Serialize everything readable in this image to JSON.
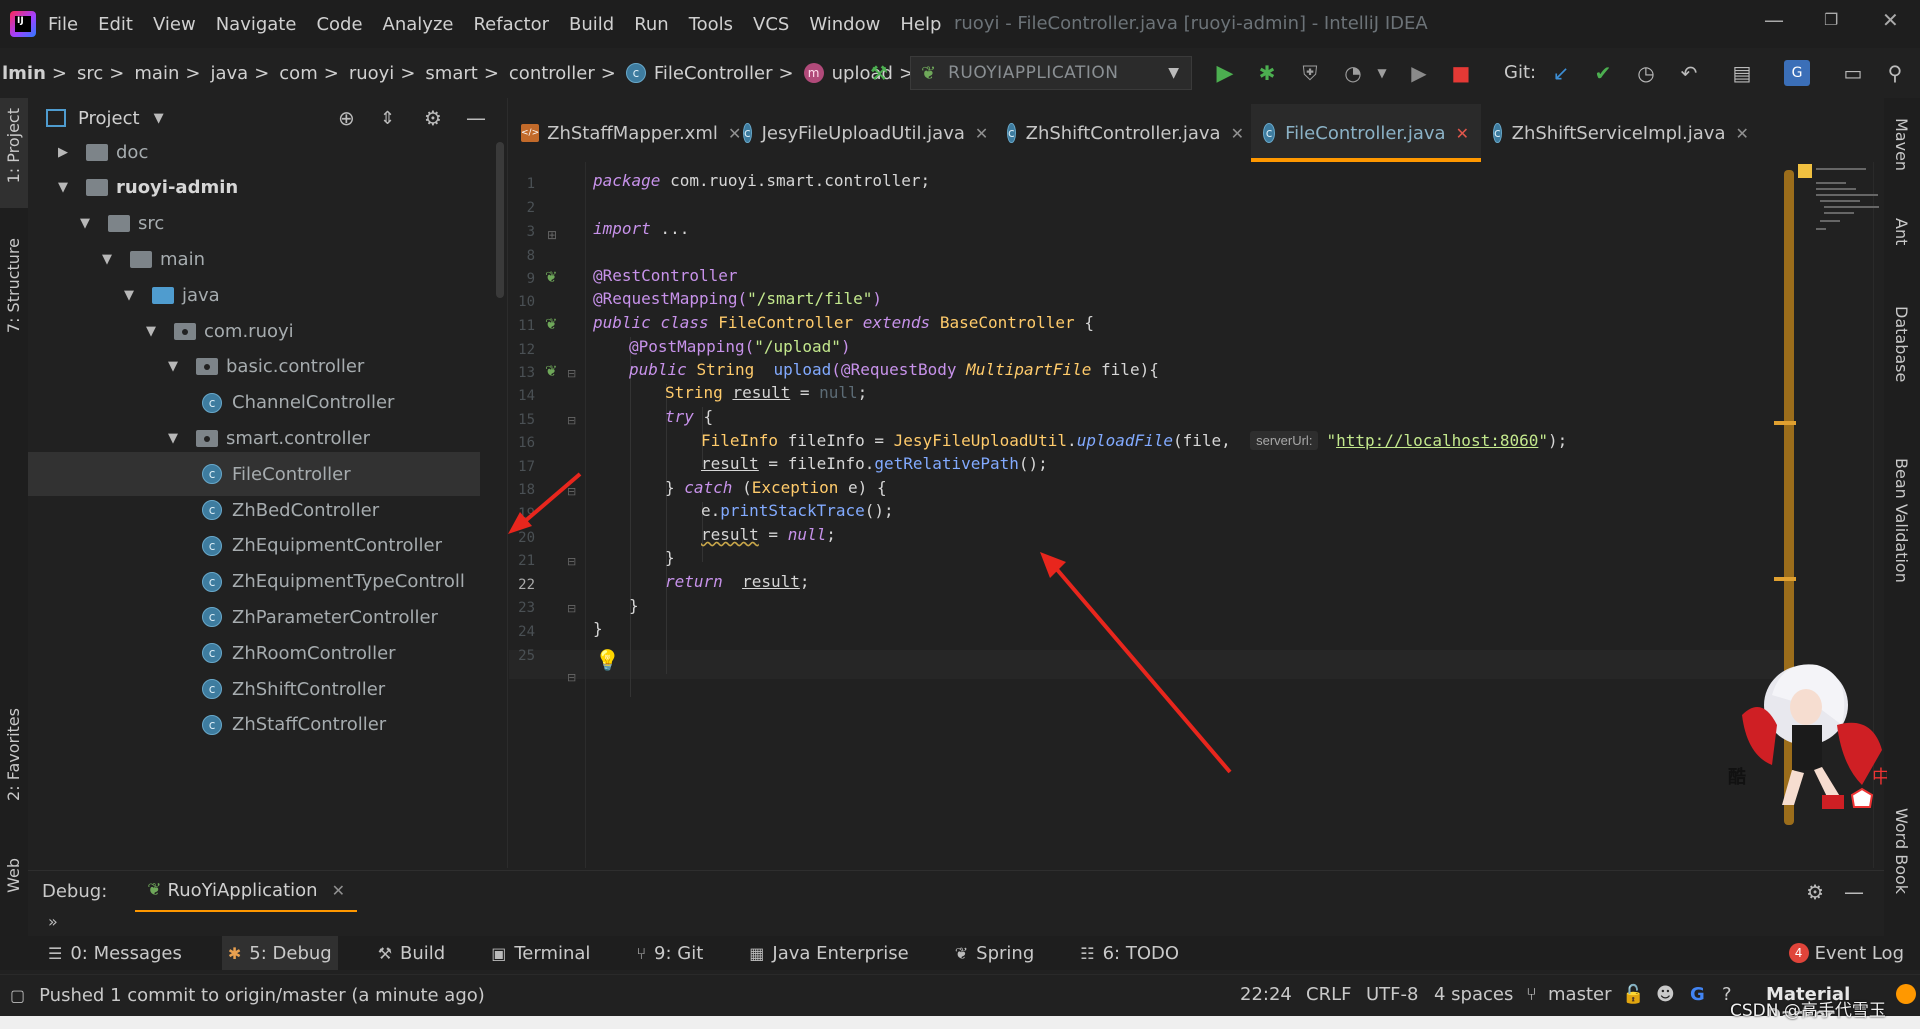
{
  "window": {
    "title": "ruoyi - FileController.java [ruoyi-admin] - IntelliJ IDEA"
  },
  "menu": [
    "File",
    "Edit",
    "View",
    "Navigate",
    "Code",
    "Analyze",
    "Refactor",
    "Build",
    "Run",
    "Tools",
    "VCS",
    "Window",
    "Help"
  ],
  "breadcrumb": [
    "lmin",
    "src",
    "main",
    "java",
    "com",
    "ruoyi",
    "smart",
    "controller",
    "FileController",
    "upload"
  ],
  "toolbar": {
    "run_config": "RUOYIAPPLICATION",
    "git_label": "Git:"
  },
  "left_strip": {
    "project": "1: Project",
    "structure": "7: Structure",
    "favorites": "2: Favorites",
    "web": "Web"
  },
  "right_strip": {
    "maven": "Maven",
    "ant": "Ant",
    "database": "Database",
    "bean_validation": "Bean Validation",
    "word_book": "Word Book"
  },
  "project_panel": {
    "title": "Project",
    "tree": [
      {
        "label": "doc",
        "arrow": "▶",
        "icon": "folder"
      },
      {
        "label": "ruoyi-admin",
        "arrow": "▼",
        "icon": "module"
      },
      {
        "label": "src",
        "arrow": "▼",
        "icon": "folder"
      },
      {
        "label": "main",
        "arrow": "▼",
        "icon": "folder"
      },
      {
        "label": "java",
        "arrow": "▼",
        "icon": "source-folder"
      },
      {
        "label": "com.ruoyi",
        "arrow": "▼",
        "icon": "package"
      },
      {
        "label": "basic.controller",
        "arrow": "▼",
        "icon": "package"
      },
      {
        "label": "ChannelController",
        "arrow": "",
        "icon": "class"
      },
      {
        "label": "smart.controller",
        "arrow": "▼",
        "icon": "package"
      },
      {
        "label": "FileController",
        "arrow": "",
        "icon": "class",
        "selected": true
      },
      {
        "label": "ZhBedController",
        "arrow": "",
        "icon": "class"
      },
      {
        "label": "ZhEquipmentController",
        "arrow": "",
        "icon": "class"
      },
      {
        "label": "ZhEquipmentTypeControll",
        "arrow": "",
        "icon": "class"
      },
      {
        "label": "ZhParameterController",
        "arrow": "",
        "icon": "class"
      },
      {
        "label": "ZhRoomController",
        "arrow": "",
        "icon": "class"
      },
      {
        "label": "ZhShiftController",
        "arrow": "",
        "icon": "class"
      },
      {
        "label": "ZhStaffController",
        "arrow": "",
        "icon": "class"
      }
    ]
  },
  "tabs": [
    {
      "label": "ZhStaffMapper.xml",
      "icon": "xml"
    },
    {
      "label": "JesyFileUploadUtil.java",
      "icon": "class"
    },
    {
      "label": "ZhShiftController.java",
      "icon": "class"
    },
    {
      "label": "FileController.java",
      "icon": "class",
      "active": true
    },
    {
      "label": "ZhShiftServiceImpl.java",
      "icon": "class"
    }
  ],
  "editor": {
    "line_numbers": [
      "1",
      "2",
      "3",
      "8",
      "9",
      "10",
      "11",
      "12",
      "13",
      "14",
      "15",
      "16",
      "17",
      "18",
      "19",
      "20",
      "21",
      "22",
      "23",
      "24",
      "25"
    ],
    "code": {
      "l1_kw": "package",
      "l1_rest": " com.ruoyi.smart.controller;",
      "l3_kw": "import",
      "l3_rest": " ...",
      "l9": "@RestController",
      "l10_ann": "@RequestMapping(",
      "l10_str": "\"/smart/file\"",
      "l10_end": ")",
      "l11_kw1": "public",
      "l11_kw2": "class",
      "l11_name": "FileController",
      "l11_kw3": "extends",
      "l11_base": "BaseController",
      "l11_end": " {",
      "l12_ann": "@PostMapping(",
      "l12_str": "\"/upload\"",
      "l12_end": ")",
      "l13_kw": "public",
      "l13_type": "String",
      "l13_fn": "upload",
      "l13_ann": "(@RequestBody",
      "l13_ptype": "MultipartFile",
      "l13_rest": " file){",
      "l14_type": "String",
      "l14_var": "result",
      "l14_eq": " = ",
      "l14_null": "null",
      "l14_end": ";",
      "l15_kw": "try",
      "l15_end": " {",
      "l16_type": "FileInfo",
      "l16_var": " fileInfo = ",
      "l16_cls": "JesyFileUploadUtil",
      "l16_dot": ".",
      "l16_fn": "uploadFile",
      "l16_args": "(file, ",
      "l16_hint": "serverUrl:",
      "l16_q1": "\"",
      "l16_url": "http://localhost:8060",
      "l16_q2": "\"",
      "l16_end": ");",
      "l17_var": "result",
      "l17_mid": " = fileInfo.",
      "l17_fn": "getRelativePath",
      "l17_end": "();",
      "l18_pre": "} ",
      "l18_kw": "catch",
      "l18_mid": " (",
      "l18_type": "Exception",
      "l18_end": " e) {",
      "l19_var": "e.",
      "l19_fn": "printStackTrace",
      "l19_end": "();",
      "l20_var": "result",
      "l20_eq": " = ",
      "l20_null": "null",
      "l20_end": ";",
      "l21": "}",
      "l22_kw": "return",
      "l22_var": "result",
      "l22_end": ";",
      "l23": "}",
      "l24": "}"
    }
  },
  "debug": {
    "label": "Debug:",
    "session": "RuoYiApplication",
    "chevron": "»"
  },
  "tool_windows": [
    {
      "label": "0: Messages",
      "icon": "messages-icon"
    },
    {
      "label": "5: Debug",
      "icon": "debug-icon",
      "active": true
    },
    {
      "label": "Build",
      "icon": "build-icon"
    },
    {
      "label": "Terminal",
      "icon": "terminal-icon"
    },
    {
      "label": "9: Git",
      "icon": "git-icon"
    },
    {
      "label": "Java Enterprise",
      "icon": "java-enterprise-icon"
    },
    {
      "label": "Spring",
      "icon": "spring-icon"
    },
    {
      "label": "6: TODO",
      "icon": "todo-icon"
    }
  ],
  "event_log": {
    "count": "4",
    "label": "Event Log"
  },
  "status": {
    "message": "Pushed 1 commit to origin/master (a minute ago)",
    "position": "22:24",
    "line_sep": "CRLF",
    "encoding": "UTF-8",
    "indent": "4 spaces",
    "branch": "master",
    "theme": "Material Darker"
  },
  "watermark": "CSDN @高手代雪玉",
  "colors": {
    "accent": "#ff9800",
    "arrow": "#e8261d",
    "run_green": "#4caf50",
    "stop_red": "#e53935"
  }
}
